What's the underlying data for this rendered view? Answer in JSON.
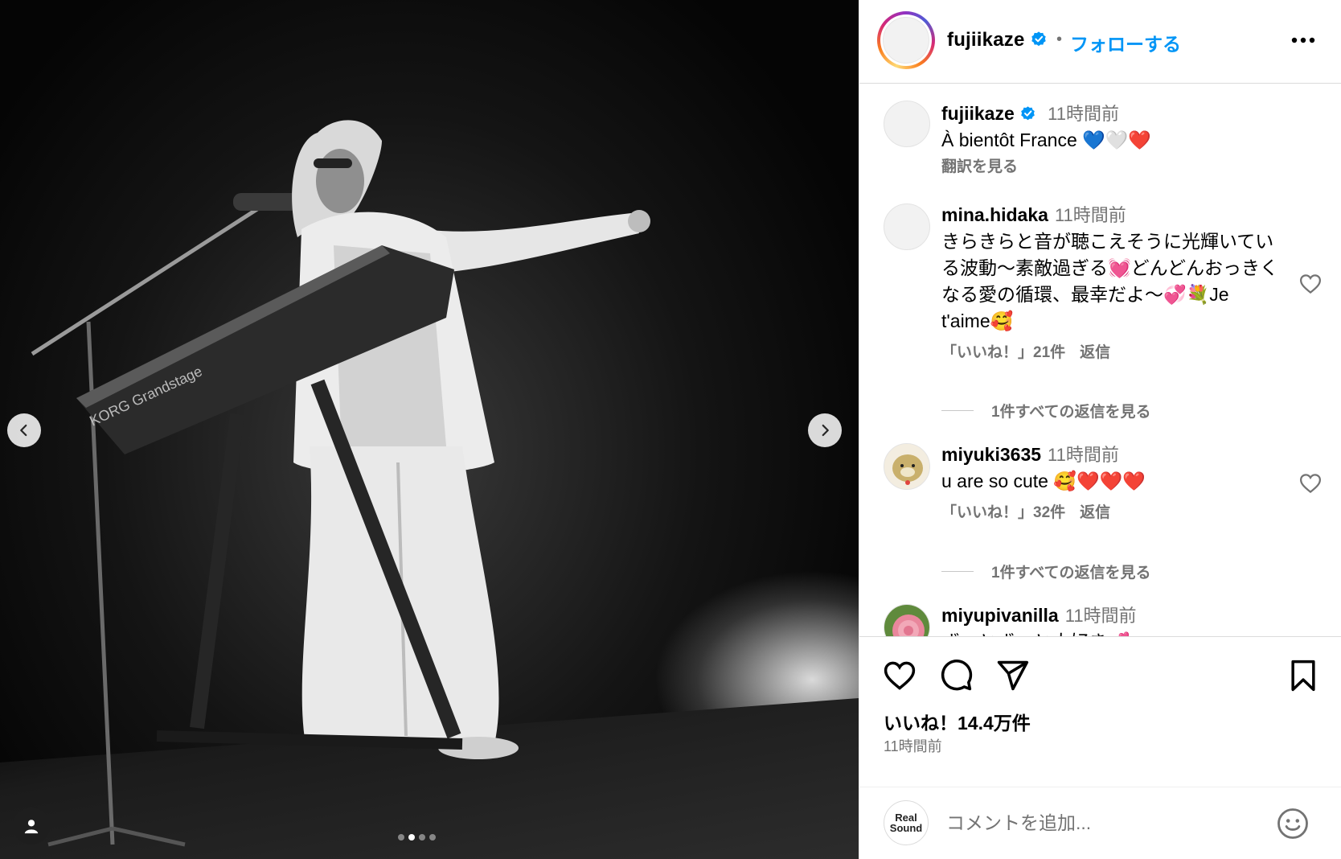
{
  "post": {
    "dots_count": 4,
    "active_dot": 1
  },
  "header": {
    "username": "fujiikaze",
    "separator": "•",
    "follow_label": "フォローする"
  },
  "caption": {
    "username": "fujiikaze",
    "time": "11時間前",
    "text": "À bientôt France 💙🤍❤️",
    "translate_label": "翻訳を見る"
  },
  "comments": [
    {
      "username": "mina.hidaka",
      "time": "11時間前",
      "text": "きらきらと音が聴こえそうに光輝いている波動〜素敵過ぎる💓どんどんおっきくなる愛の循環、最幸だよ〜💞💐Je t'aime🥰",
      "likes": "「いいね！」21件",
      "reply_label": "返信",
      "view_replies": "1件すべての返信を見る"
    },
    {
      "username": "miyuki3635",
      "time": "11時間前",
      "text": "u are so cute 🥰❤️❤️❤️",
      "likes": "「いいね！」32件",
      "reply_label": "返信",
      "view_replies": "1件すべての返信を見る"
    },
    {
      "username": "miyupivanilla",
      "time": "11時間前",
      "text": "ずっとずっと大好き💕"
    }
  ],
  "footer": {
    "likes": "いいね！14.4万件",
    "time": "11時間前",
    "my_avatar_line1": "Real",
    "my_avatar_line2": "Sound",
    "comment_placeholder": "コメントを追加..."
  },
  "colors": {
    "accent": "#0095f6",
    "secondary_text": "#737373",
    "divider": "#dbdbdb"
  },
  "icons": {
    "header": [
      "verified-badge-icon",
      "more-options-icon"
    ],
    "media": [
      "chevron-left-icon",
      "chevron-right-icon",
      "user-tag-icon"
    ],
    "actions": [
      "heart-icon",
      "comment-icon",
      "share-icon",
      "bookmark-icon",
      "emoji-icon"
    ]
  }
}
